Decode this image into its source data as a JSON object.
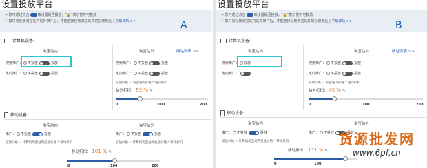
{
  "panel_a": {
    "title": "设置投放平台",
    "notice_line1_pre": "您可通过点击",
    "notice_line1_post": "来设置是否投放，\"🔒\"表示暂不可投放",
    "notice_line2": "您只有投放淘宝站内站外推广后，才能选择投放淘宝站外的投放地区 | ",
    "notice_link": "了解详情 >>",
    "panel_label": "A",
    "desktop_section": "计算机设备:",
    "mobile_section": "移动设备:",
    "desktop": {
      "col_in": "淘宝站内",
      "col_out": "淘宝站外",
      "site_link": "网站列表 >>",
      "search_label": "搜索推广：",
      "no_serve": "不投放",
      "serve": "投放",
      "targeted_label": "定向推广：",
      "bid_formula": "投放价格 = 淘宝站内价格 * 站外折扣",
      "discount_label": "站外折扣：",
      "discount_value": "52 %",
      "discount_level_pct": 52,
      "ticks": [
        "0",
        "100",
        "200"
      ]
    },
    "mobile": {
      "col_in": "淘宝站内",
      "col_out": "淘宝站外",
      "promo_label": "推广：",
      "no_serve": "不投放",
      "serve": "投放",
      "formula_in": "投放价格 = 计算机淘宝站内投放价格 * 移动折扣",
      "formula_out": "投放价格 = 计算机淘宝站外投放价格 * 移动折扣",
      "discount_label": "移动折扣：",
      "discount_value": "101 %",
      "discount_level_pct": 101,
      "ticks": [
        "0",
        "100",
        "200"
      ]
    }
  },
  "panel_b": {
    "title": "设置投放平台",
    "notice_line1_pre": "您可通过点击",
    "notice_line1_post": "来设置是否投放，\"🔒\"表示暂不可投放",
    "notice_line2": "您只有投放淘宝站内站外推广后，才能选择投放淘宝站外的投放地区 | ",
    "notice_link": "了解详情 >>",
    "panel_label": "B",
    "desktop_section": "计算机设备:",
    "mobile_section": "移动设备:",
    "desktop": {
      "col_in": "淘宝站内",
      "col_out": "淘宝站外",
      "site_link": "网站列表 >>",
      "search_label": "搜索推广：",
      "serve": "投放",
      "no_serve": "不投放",
      "targeted_label": "定向推广：",
      "bid_formula": "投放价格 = 淘宝站内价格 * 站外折扣",
      "discount_label": "站外折扣：",
      "discount_value": "45 %",
      "discount_level_pct": 45,
      "ticks": [
        "0",
        "100",
        "200"
      ]
    },
    "mobile": {
      "col_in": "淘宝站内",
      "col_out": "淘宝站外",
      "promo_label": "推广：",
      "no_serve": "不投放",
      "serve": "投放",
      "formula_in": "投放价格 = 计算机淘宝站内投放价格 * 移动折扣",
      "discount_label": "移动折扣：",
      "discount_value": "171 %",
      "discount_level_pct": 171,
      "ticks": [
        "0",
        "100"
      ]
    }
  },
  "watermark": {
    "text": "货源批发网",
    "url": "www.6pf.cn"
  },
  "colors": {
    "accent": "#2c5ea8",
    "highlight": "#2ec4d6",
    "percent": "#e07b2a",
    "watermark": "#d96a19"
  }
}
